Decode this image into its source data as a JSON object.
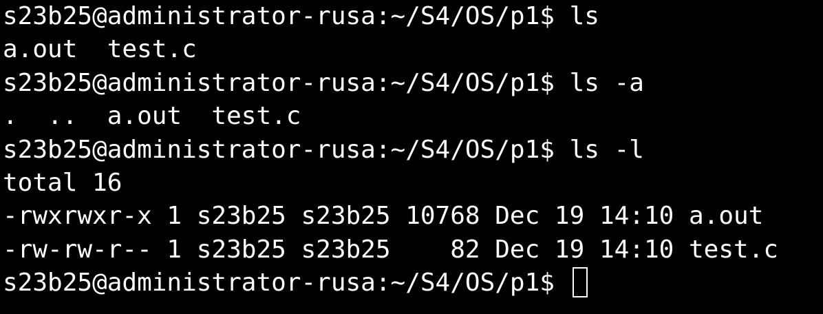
{
  "terminal": {
    "lines": [
      "s23b25@administrator-rusa:~/S4/OS/p1$ ls",
      "a.out  test.c",
      "s23b25@administrator-rusa:~/S4/OS/p1$ ls -a",
      ".  ..  a.out  test.c",
      "s23b25@administrator-rusa:~/S4/OS/p1$ ls -l",
      "total 16",
      "-rwxrwxr-x 1 s23b25 s23b25 10768 Dec 19 14:10 a.out",
      "-rw-rw-r-- 1 s23b25 s23b25    82 Dec 19 14:10 test.c"
    ],
    "prompt": "s23b25@administrator-rusa:~/S4/OS/p1$ ",
    "background_color": "#000000",
    "text_color": "#ffffff",
    "cursor_style": "hollow-block"
  }
}
